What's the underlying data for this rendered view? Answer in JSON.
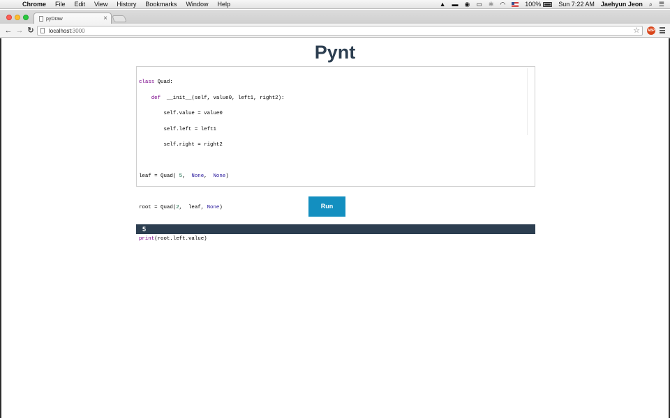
{
  "menubar": {
    "app_name": "Chrome",
    "items": [
      "File",
      "Edit",
      "View",
      "History",
      "Bookmarks",
      "Window",
      "Help"
    ],
    "battery": "100%",
    "clock": "Sun 7:22 AM",
    "user": "Jaehyun Jeon"
  },
  "browser": {
    "tab_title": "pyDraw",
    "url_host": "localhost",
    "url_port": ":3000"
  },
  "page": {
    "title": "Pynt",
    "run_label": "Run",
    "output": "5"
  },
  "code": {
    "l1a": "class",
    "l1b": " Quad:",
    "l2a": "    def",
    "l2b": "  __init__(self, value0, left1, right2):",
    "l3": "        self.value = value0",
    "l4": "        self.left = left1",
    "l5": "        self.right = right2",
    "l7a": "leaf = Quad( ",
    "l7b": "5",
    "l7c": ",  ",
    "l7d": "None",
    "l7e": ",  ",
    "l7f": "None",
    "l7g": ")",
    "l9a": "root = Quad(",
    "l9b": "2",
    "l9c": ",  leaf, ",
    "l9d": "None",
    "l9e": ")",
    "l11a": "print",
    "l11b": "(root.left.value)"
  },
  "colors": {
    "title": "#2c3e50",
    "run_button": "#138fc0",
    "output_bar": "#2c3e50",
    "keyword": "#770088",
    "number": "#116644",
    "atom": "#221199"
  }
}
